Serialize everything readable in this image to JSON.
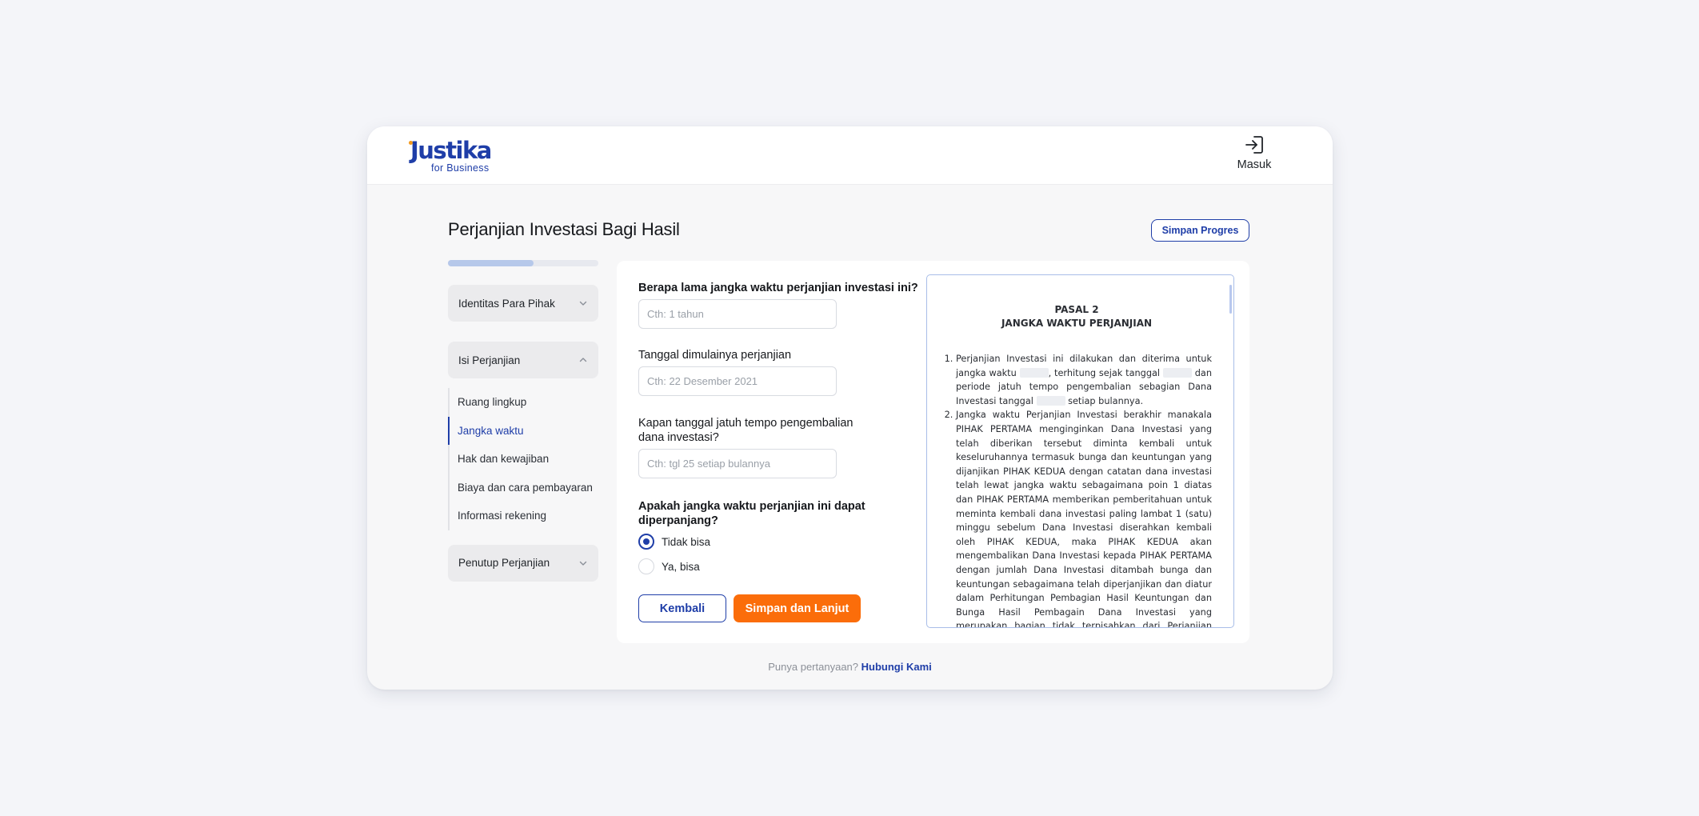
{
  "brand": {
    "name": "Justika",
    "tagline": "for Business"
  },
  "header": {
    "login_label": "Masuk"
  },
  "page": {
    "title": "Perjanjian Investasi Bagi Hasil",
    "save_progress_label": "Simpan Progres",
    "progress_fraction": 0.57
  },
  "sidebar": {
    "sections": [
      {
        "label": "Identitas Para Pihak",
        "expanded": false
      },
      {
        "label": "Isi Perjanjian",
        "expanded": true
      },
      {
        "label": "Penutup Perjanjian",
        "expanded": false
      }
    ],
    "sub_items": [
      {
        "label": "Ruang lingkup",
        "active": false
      },
      {
        "label": "Jangka waktu",
        "active": true
      },
      {
        "label": "Hak dan kewajiban",
        "active": false
      },
      {
        "label": "Biaya dan cara pembayaran",
        "active": false
      },
      {
        "label": "Informasi rekening",
        "active": false
      }
    ]
  },
  "form": {
    "q1": {
      "label": "Berapa lama jangka waktu perjanjian investasi ini?",
      "value": "",
      "placeholder": "Cth: 1 tahun"
    },
    "q2": {
      "label": "Tanggal dimulainya perjanjian",
      "value": "",
      "placeholder": "Cth: 22 Desember 2021"
    },
    "q3": {
      "label_line1": "Kapan tanggal jatuh tempo pengembalian",
      "label_line2": "dana investasi?",
      "value": "",
      "placeholder": "Cth: tgl 25 setiap bulannya"
    },
    "q4": {
      "label_line1": "Apakah jangka waktu perjanjian ini dapat",
      "label_line2": "diperpanjang?",
      "options": [
        {
          "label": "Tidak bisa",
          "selected": true
        },
        {
          "label": "Ya, bisa",
          "selected": false
        }
      ]
    },
    "back_label": "Kembali",
    "next_label": "Simpan dan Lanjut"
  },
  "document": {
    "pasal": "PASAL 2",
    "heading": "JANGKA WAKTU PERJANJIAN",
    "item1": {
      "p1": "Perjanjian Investasi ini dilakukan dan diterima untuk jangka waktu",
      "p2": ", terhitung sejak tanggal",
      "p3": "dan periode jatuh tempo pengembalian sebagian Dana Investasi tanggal",
      "p4": "setiap bulannya."
    },
    "item2": "Jangka waktu Perjanjian Investasi berakhir manakala PIHAK PERTAMA menginginkan Dana Investasi yang telah diberikan tersebut diminta kembali untuk keseluruhannya termasuk bunga dan keuntungan yang dijanjikan PIHAK KEDUA dengan catatan dana investasi telah lewat jangka waktu sebagaimana poin 1 diatas dan PIHAK PERTAMA memberikan pemberitahuan untuk meminta kembali dana investasi paling lambat 1 (satu) minggu sebelum Dana Investasi diserahkan kembali oleh PIHAK KEDUA, maka PIHAK KEDUA akan mengembalikan Dana Investasi kepada PIHAK PERTAMA dengan jumlah Dana Investasi ditambah bunga dan keuntungan sebagaimana telah diperjanjikan dan diatur dalam Perhitungan Pembagian Hasil Keuntungan dan Bunga Hasil Pembagain Dana Investasi yang merupakan bagian tidak terpisahkan dari Perjanjian Investasi ini."
  },
  "footer": {
    "question": "Punya pertanyaan?",
    "link_label": "Hubungi Kami"
  },
  "colors": {
    "brand_blue": "#1f3ea8",
    "accent_orange": "#fb6d0a",
    "logo_dot": "#f39a1e"
  }
}
